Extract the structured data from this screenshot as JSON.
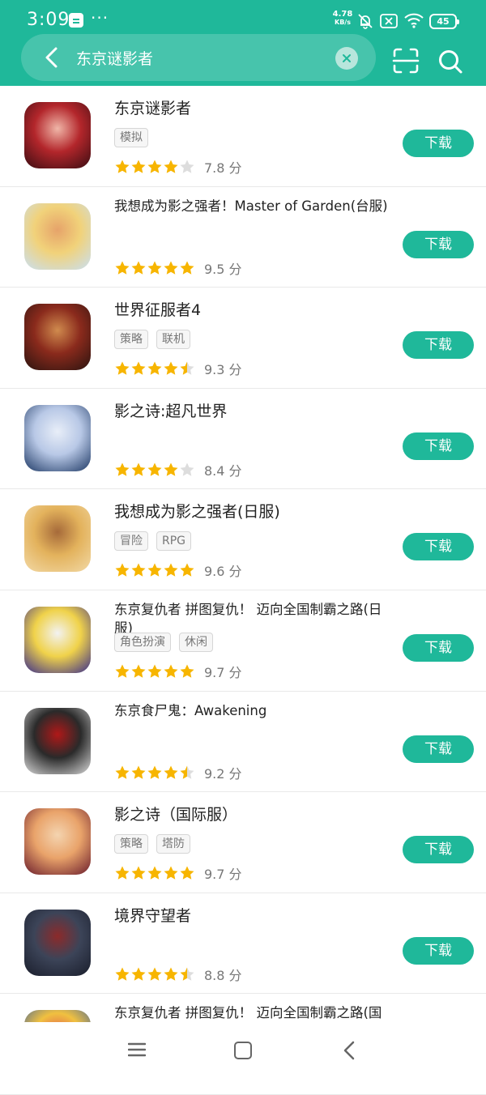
{
  "status": {
    "time": "3:09",
    "speed_value": "4.78",
    "speed_unit": "KB/s",
    "battery": "45"
  },
  "search": {
    "query": "东京谜影者"
  },
  "colors": {
    "accent": "#1fb89a",
    "star": "#f7b500",
    "star_empty": "#dddddd"
  },
  "results": [
    {
      "title": "东京谜影者",
      "tags": [
        "模拟"
      ],
      "stars": 4,
      "score": "7.8 分",
      "action": "下载",
      "icon": "red-hair-character-icon"
    },
    {
      "title": "我想成为影之强者！Master of Garden(台服)",
      "tags": [],
      "stars": 5,
      "score": "9.5 分",
      "action": "下载",
      "icon": "blonde-elf-character-icon"
    },
    {
      "title": "世界征服者4",
      "tags": [
        "策略",
        "联机"
      ],
      "stars": 4.5,
      "score": "9.3 分",
      "action": "下载",
      "icon": "officer-character-icon"
    },
    {
      "title": "影之诗:超凡世界",
      "tags": [],
      "stars": 4,
      "score": "8.4 分",
      "action": "下载",
      "icon": "silver-hair-character-icon"
    },
    {
      "title": "我想成为影之强者(日服)",
      "tags": [
        "冒险",
        "RPG"
      ],
      "stars": 5,
      "score": "9.6 分",
      "action": "下载",
      "icon": "blonde-character-icon"
    },
    {
      "title": "东京复仇者 拼图复仇！ 迈向全国制霸之路(日服)",
      "tags": [
        "角色扮演",
        "休闲"
      ],
      "stars": 5,
      "score": "9.7 分",
      "action": "下载",
      "icon": "event-banner-icon"
    },
    {
      "title": "东京食尸鬼：Awakening",
      "tags": [],
      "stars": 4.5,
      "score": "9.2 分",
      "action": "下载",
      "icon": "masked-character-icon"
    },
    {
      "title": "影之诗（国际服）",
      "tags": [
        "策略",
        "塔防"
      ],
      "stars": 5,
      "score": "9.7 分",
      "action": "下载",
      "icon": "red-hair-girl-icon"
    },
    {
      "title": "境界守望者",
      "tags": [],
      "stars": 4.5,
      "score": "8.8 分",
      "action": "下载",
      "icon": "werewolf-icon"
    },
    {
      "title": "东京复仇者 拼图复仇！ 迈向全国制霸之路(国际服)",
      "tags": [],
      "stars": 0,
      "score": "",
      "action": "",
      "icon": "partial-app-icon"
    }
  ]
}
